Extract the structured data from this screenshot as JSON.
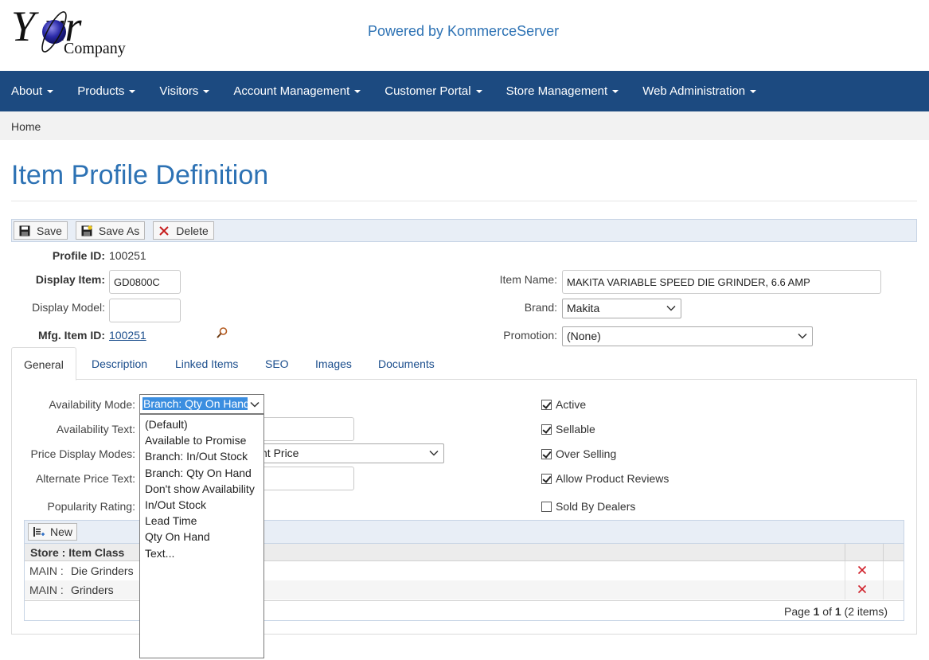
{
  "header": {
    "logo_main": "Y ur",
    "logo_sub": "Company",
    "powered_by": "Powered by KommerceServer"
  },
  "nav": {
    "items": [
      "About",
      "Products",
      "Visitors",
      "Account Management",
      "Customer Portal",
      "Store Management",
      "Web Administration"
    ]
  },
  "breadcrumb": "Home",
  "page_title": "Item Profile Definition",
  "toolbar": {
    "save": "Save",
    "save_as": "Save As",
    "delete": "Delete"
  },
  "form": {
    "profile_id_label": "Profile ID:",
    "profile_id_value": "100251",
    "display_item_label": "Display Item:",
    "display_item_value": "GD0800C",
    "display_model_label": "Display Model:",
    "display_model_value": "",
    "mfg_item_id_label": "Mfg. Item ID:",
    "mfg_item_id_value": "100251",
    "item_name_label": "Item Name:",
    "item_name_value": "MAKITA VARIABLE SPEED DIE GRINDER, 6.6 AMP",
    "brand_label": "Brand:",
    "brand_value": "Makita",
    "promotion_label": "Promotion:",
    "promotion_value": "(None)"
  },
  "tabs": [
    "General",
    "Description",
    "Linked Items",
    "SEO",
    "Images",
    "Documents"
  ],
  "general": {
    "availability_mode_label": "Availability Mode:",
    "availability_mode_value": "Branch: Qty On Hand",
    "availability_text_label": "Availability Text:",
    "availability_text_value": "",
    "price_display_modes_label": "Price Display Modes:",
    "price_display_modes_value": "nt Price",
    "alternate_price_text_label": "Alternate Price Text:",
    "alternate_price_text_value": "",
    "popularity_rating_label": "Popularity Rating:",
    "checkboxes": [
      {
        "label": "Active",
        "checked": true
      },
      {
        "label": "Sellable",
        "checked": true
      },
      {
        "label": "Over Selling",
        "checked": true
      },
      {
        "label": "Allow Product Reviews",
        "checked": true
      },
      {
        "label": "Sold By Dealers",
        "checked": false
      }
    ],
    "availability_options": [
      "(Default)",
      "Available to Promise",
      "Branch: In/Out Stock",
      "Branch: Qty On Hand",
      "Don't show Availability",
      "In/Out Stock",
      "Lead Time",
      "Qty On Hand",
      "Text..."
    ]
  },
  "grid": {
    "new_label": "New",
    "header": "Store : Item Class",
    "rows": [
      {
        "store": "MAIN :",
        "item_class": "Die Grinders"
      },
      {
        "store": "MAIN :",
        "item_class": "Grinders"
      }
    ],
    "pager": {
      "prefix": "Page ",
      "page": "1",
      "of": " of ",
      "total": "1",
      "items": " (2 items)"
    }
  },
  "colors": {
    "nav_bg": "#1c4a80",
    "title": "#2d72b4",
    "link": "#1a4d8c",
    "delete_x": "#d0202a",
    "selection": "#3b8ee0"
  }
}
